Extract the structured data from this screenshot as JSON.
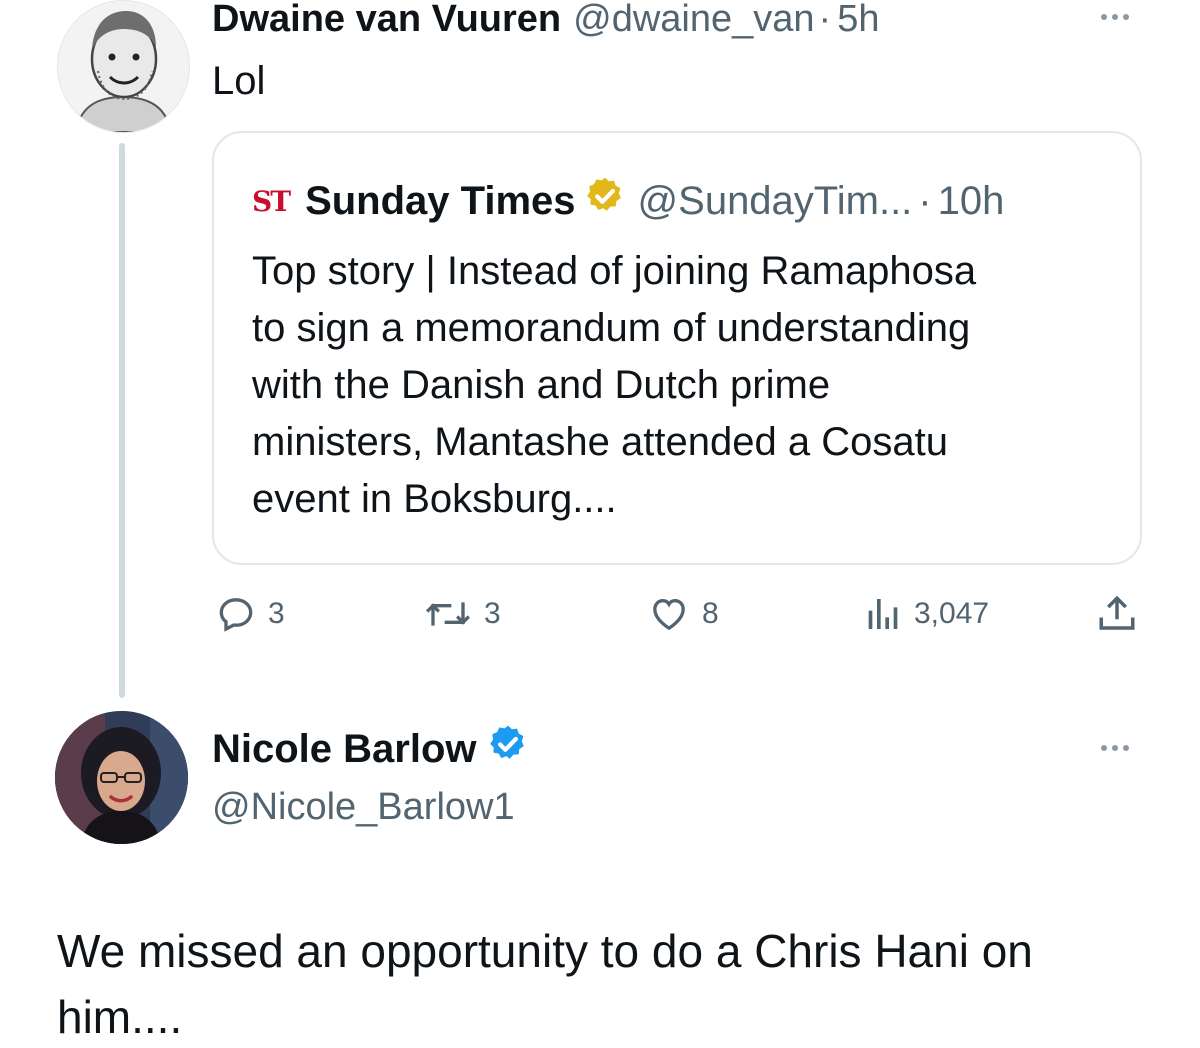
{
  "reply_tweet": {
    "author_name": "Dwaine van Vuuren",
    "handle": "@dwaine_van",
    "separator": "·",
    "time": "5h",
    "text": "Lol"
  },
  "quoted_tweet": {
    "source_logo": "ST",
    "author_name": "Sunday Times",
    "handle": "@SundayTim...",
    "separator": "·",
    "time": "10h",
    "verified_badge": "gold-verified-icon",
    "lines": [
      "Top story | Instead of joining Ramaphosa",
      "to sign a memorandum of understanding",
      "with the Danish and Dutch prime",
      "ministers, Mantashe attended a Cosatu",
      "event in Boksburg...."
    ]
  },
  "actions": {
    "replies": "3",
    "reposts": "3",
    "likes": "8",
    "views": "3,047"
  },
  "main_tweet": {
    "author_name": "Nicole Barlow",
    "handle": "@Nicole_Barlow1",
    "verified_badge": "blue-verified-icon",
    "text_lines": [
      "We missed an opportunity to do a Chris Hani on",
      "him...."
    ]
  },
  "colors": {
    "text": "#0f1419",
    "muted": "#536471",
    "border": "#e1e8ed",
    "thread_line": "#cfd9de",
    "blue_verified": "#1d9bf0",
    "gold_verified": "#e2b719",
    "st_logo_red": "#c8102e"
  }
}
